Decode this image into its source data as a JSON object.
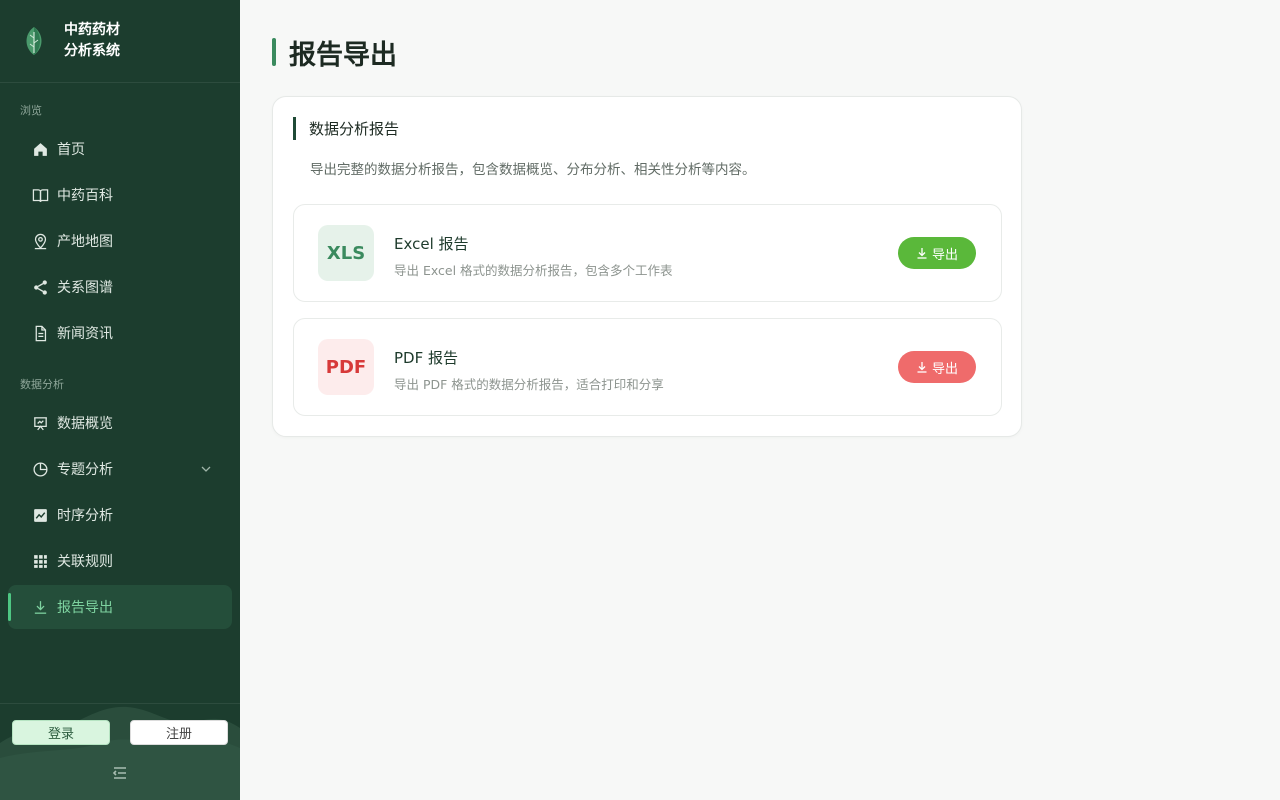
{
  "app": {
    "title_line1": "中药药材",
    "title_line2": "分析系统"
  },
  "sidebar": {
    "group_browse": "浏览",
    "group_analysis": "数据分析",
    "items": [
      {
        "label": "首页",
        "icon": "home-icon"
      },
      {
        "label": "中药百科",
        "icon": "book-icon"
      },
      {
        "label": "产地地图",
        "icon": "map-pin-icon"
      },
      {
        "label": "关系图谱",
        "icon": "share-icon"
      },
      {
        "label": "新闻资讯",
        "icon": "document-icon"
      },
      {
        "label": "数据概览",
        "icon": "presentation-icon"
      },
      {
        "label": "专题分析",
        "icon": "pie-chart-icon",
        "has_submenu": true
      },
      {
        "label": "时序分析",
        "icon": "line-chart-icon"
      },
      {
        "label": "关联规则",
        "icon": "grid-icon"
      },
      {
        "label": "报告导出",
        "icon": "download-icon",
        "active": true
      }
    ],
    "login_label": "登录",
    "register_label": "注册"
  },
  "main": {
    "page_title": "报告导出",
    "section": {
      "title": "数据分析报告",
      "description": "导出完整的数据分析报告，包含数据概览、分布分析、相关性分析等内容。",
      "exports": [
        {
          "badge": "XLS",
          "name": "Excel 报告",
          "description": "导出 Excel 格式的数据分析报告，包含多个工作表",
          "button": "导出",
          "badge_color": "#3a8a5e",
          "badge_bg": "#e6f2ea",
          "button_color": "#5ab83a"
        },
        {
          "badge": "PDF",
          "name": "PDF 报告",
          "description": "导出 PDF 格式的数据分析报告，适合打印和分享",
          "button": "导出",
          "badge_color": "#d73a3a",
          "badge_bg": "#fdecec",
          "button_color": "#ef6b6b"
        }
      ]
    }
  },
  "colors": {
    "sidebar_bg": "#1c3d2e",
    "accent": "#3a8a5e",
    "active_text": "#7ed3a0"
  }
}
